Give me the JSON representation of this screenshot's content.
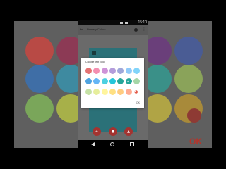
{
  "app": {
    "title": "Primary Colour",
    "status_time": "15:10",
    "back_icon": "arrow-left-icon",
    "palette_icon": "palette-icon",
    "more_icon": "more-vert-icon"
  },
  "background": {
    "ok_label": "OK",
    "swatches": [
      "#b84a45",
      "#8c3a55",
      "#6a3f7a",
      "#4a5c94",
      "#3f6ea6",
      "#3e8aa0",
      "#3a9088",
      "#8aa35a",
      "#7aa65a",
      "#a7b049",
      "#b0a445",
      "#a88a3a"
    ]
  },
  "dialog": {
    "title": "Choose text color",
    "ok_label": "OK",
    "selected_index": 12,
    "colors": [
      "#e57373",
      "#f06292",
      "#ba68c8",
      "#9575cd",
      "#7986cb",
      "#64b5f6",
      "#4fc3f7",
      "#4dd0e1",
      "#4db6ac",
      "#81c784",
      "#aed581",
      "#dce775",
      "#fff176",
      "#ffd54f",
      "#ffb74d",
      "#ff8a65",
      "#a1887f",
      "#90a4ae",
      "#e0e0e0",
      "#ef9a9a",
      "#f48fb1"
    ],
    "grid": [
      [
        "#e57373",
        "#f48fb1",
        "#ce93d8",
        "#b39ddb",
        "#9fa8da",
        "#90caf9",
        "#81d4fa"
      ],
      [
        "#4fa3e0",
        "#64b5f6",
        "#4dd0e1",
        "#26c6da",
        "#26a69a",
        "#26a69a",
        "#a5d6a7"
      ],
      [
        "#c5e1a5",
        "#e6ee9c",
        "#fff59d",
        "#ffe082",
        "#ffcc80",
        "#ffab91",
        "#ffffff"
      ]
    ],
    "custom_icon": "palette-icon"
  },
  "fabs": [
    {
      "icon": "add-icon"
    },
    {
      "icon": "color-icon"
    },
    {
      "icon": "share-icon"
    }
  ],
  "nav": {
    "back_icon": "nav-back-icon",
    "home_icon": "nav-home-icon",
    "recent_icon": "nav-recent-icon"
  }
}
